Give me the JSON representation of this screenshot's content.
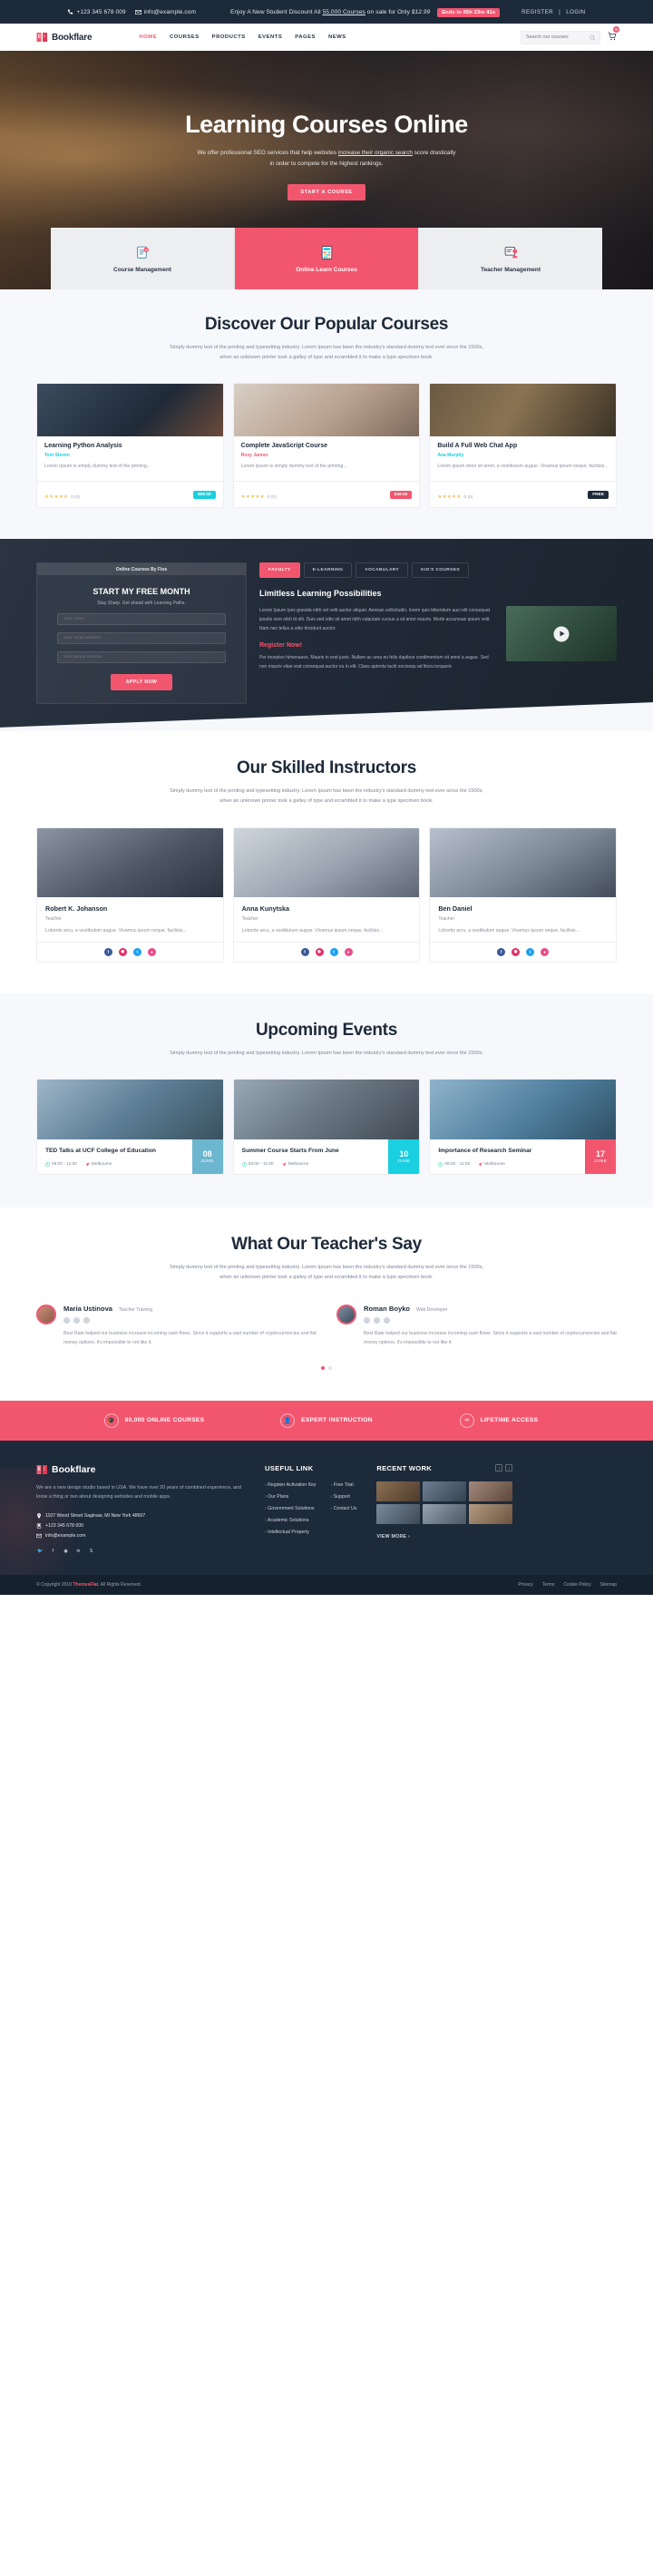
{
  "topbar": {
    "phone": "+123 345 678 009",
    "email": "info@example.com",
    "promo_pre": "Enjoy A New Student Discount All ",
    "promo_link": "55,000 Courses",
    "promo_mid": " on sale for Only",
    "promo_price": "$12.99",
    "countdown": "Ends in 05h 23m 41s",
    "register": "REGISTER",
    "login": "LOGIN"
  },
  "nav": {
    "brand": "Bookflare",
    "items": [
      {
        "label": "HOME",
        "active": true
      },
      {
        "label": "COURSES",
        "active": false
      },
      {
        "label": "PRODUCTS",
        "active": false
      },
      {
        "label": "EVENTS",
        "active": false
      },
      {
        "label": "PAGES",
        "active": false
      },
      {
        "label": "NEWS",
        "active": false
      }
    ],
    "search_placeholder": "Search our courses",
    "cart_count": "0"
  },
  "hero": {
    "title": "Learning Courses Online",
    "sub_line1_a": "We offer professional SEO services that help websites ",
    "sub_line1_u": "increase their organic search",
    "sub_line1_b": " score drastically",
    "sub_line2": "in order to compete for the highest rankings.",
    "cta": "START A COURSE",
    "tabs": [
      {
        "label": "Course Management",
        "icon": "clipboard-check-icon",
        "active": false
      },
      {
        "label": "Online Learn Courses",
        "icon": "calculator-icon",
        "active": true
      },
      {
        "label": "Teacher Management",
        "icon": "teacher-board-icon",
        "active": false
      }
    ]
  },
  "courses": {
    "title": "Discover Our Popular Courses",
    "subtitle": "Simply dummy text of the printing and typesetting industry. Lorem Ipsum has been the industry's standard dummy text ever since the 1500s, when an unknown printer took a galley of type and scrambled it to make a type specimen book.",
    "cards": [
      {
        "title": "Learning Python Analysis",
        "author": "Tom Steven",
        "author_color": "#19cfe0",
        "desc": "Lorem Ipsum is simply dummy text of the printing...",
        "stars": "★★★★★",
        "rating": "0 (0)",
        "price": "$89.00",
        "price_style": "cyan"
      },
      {
        "title": "Complete JavaScript Course",
        "author": "Rosy Janner",
        "author_color": "#f2566f",
        "desc": "Lorem Ipsum is simply dummy text of the printing...",
        "stars": "★★★★★",
        "rating": "0 (0)",
        "price": "$49.00",
        "price_style": "pink"
      },
      {
        "title": "Build A Full Web Chat App",
        "author": "Ana Murphy",
        "author_color": "#19cfe0",
        "desc": "Lorem ipsum dolor sit amet, a vestibulum augue. Vivamus ipsum neque, facilisis...",
        "stars": "★★★★★",
        "rating": "0 (0)",
        "price": "FREE",
        "price_style": "free"
      }
    ]
  },
  "possibilities": {
    "form_top": "Online Courses By Fios",
    "form_title": "START MY FREE MONTH",
    "form_sub": "Stay Sharp. Get ahead with Learning Paths.",
    "fields": [
      {
        "placeholder": "Your name"
      },
      {
        "placeholder": "Your email address"
      },
      {
        "placeholder": "Your phone number"
      }
    ],
    "form_btn": "APPLY NOW",
    "tabs": [
      {
        "label": "FACULTY",
        "active": true
      },
      {
        "label": "E-LEARNING",
        "active": false
      },
      {
        "label": "VOCABULARY",
        "active": false
      },
      {
        "label": "KID'S COURSES",
        "active": false
      }
    ],
    "heading": "Limitless Learning Possibilities",
    "p1": "Lorem Ipsum tyes gravida nibh vel velit auctor aliquet. Aenean sollicitudin, lorem quis bibendum auci elit consequat ipsutis sem nibh id elit. Duis sed odio sit amet nibh vulputate cursus a sit amet mauris. Morbi accumsan ipsum velit. Nam nec tellus a odio tincidunt auctor.",
    "register_title": "Register Now!",
    "p2": "Per inceptos himenaeos. Mauris in erat justo. Nullam ac urna eu felis dapibus condimentum sit amet a augue. Sed non mauris vitae erat consequat auctor eu in elit. Class aptenta taciti sociosqu ad litora torquent."
  },
  "instructors": {
    "title": "Our Skilled Instructors",
    "subtitle": "Simply dummy text of the printing and typesetting industry. Lorem Ipsum has been the industry's standard dummy text ever since the 1500s, when an unknown printer took a galley of type and scrambled it to make a type specimen book.",
    "cards": [
      {
        "name": "Robert K. Johanson",
        "role": "Teacher",
        "desc": "Lobortis arcu, a vestibulum augue. Vivamus ipsum neque, facilisis..."
      },
      {
        "name": "Anna Kunytska",
        "role": "Teacher",
        "desc": "Lobortis arcu, a vestibulum augue. Vivamus ipsum neque, facilisis..."
      },
      {
        "name": "Ben Daniel",
        "role": "Teacher",
        "desc": "Lobortis arcu, a vestibulum augue. Vivamus ipsum neque, facilisis..."
      }
    ]
  },
  "events": {
    "title": "Upcoming Events",
    "subtitle": "Simply dummy text of the printing and typesetting industry. Lorem Ipsum has been the industry's standard dummy text ever since the 1500s.",
    "cards": [
      {
        "title": "TED Talks at UCF College of Education",
        "time": "08:00 - 11:00",
        "place": "Melbourne",
        "day": "08",
        "month": "JUNE"
      },
      {
        "title": "Summer Course Starts From June",
        "time": "08:00 - 11:00",
        "place": "Melbourne",
        "day": "10",
        "month": "JUNE"
      },
      {
        "title": "Importance of Research Seminar",
        "time": "08:00 - 11:00",
        "place": "Melbourne",
        "day": "17",
        "month": "JUNE"
      }
    ]
  },
  "testimonials": {
    "title": "What Our Teacher's Say",
    "subtitle": "Simply dummy text of the printing and typesetting industry. Lorem Ipsum has been the industry's standard dummy text ever since the 1500s, when an unknown printer took a galley of type and scrambled it to make a type specimen book.",
    "items": [
      {
        "name": "Maria Ustinova",
        "role": "Teacher Training",
        "body": "Best Rate helped our business increase incoming cash flows. Since it supports a vast number of cryptocurrencies and fiat money options, it's impossible to not like it."
      },
      {
        "name": "Roman Boyko",
        "role": "Web Developer",
        "body": "Best Rate helped our business increase incoming cash flows. Since it supports a vast number of cryptocurrencies and fiat money options, it's impossible to not like it."
      }
    ]
  },
  "cta_strip": [
    {
      "label": "80,000 ONLINE COURSES",
      "icon": "graduation-cap-icon"
    },
    {
      "label": "EXPERT INSTRUCTION",
      "icon": "user-tie-icon"
    },
    {
      "label": "LIFETIME ACCESS",
      "icon": "infinity-icon"
    }
  ],
  "footer": {
    "brand": "Bookflare",
    "about": "We are a new design studio based in USA. We have over 20 years of combined experience, and know a thing or two about designing websites and mobile apps.",
    "address": "1107 Wood Street Saginaw, MI New York 48607",
    "phone": "+123 345 678 000",
    "email": "info@example.com",
    "useful_link_title": "USEFUL LINK",
    "links_col1": [
      "Register Activation Key",
      "Our Plans",
      "Government Solutions",
      "Academic Solutions",
      "Intellectual Property"
    ],
    "links_col2": [
      "Free Trial",
      "Support",
      "Contact Us"
    ],
    "recent_work_title": "RECENT WORK",
    "view_more": "VIEW MORE ›",
    "copyright_pre": "© Copyright 2019 ",
    "copyright_brand": "ThemesFlat",
    "copyright_post": ". All Rights Reserved.",
    "legal": [
      "Privacy",
      "Terms",
      "Cookie Policy",
      "Sitemap"
    ]
  }
}
